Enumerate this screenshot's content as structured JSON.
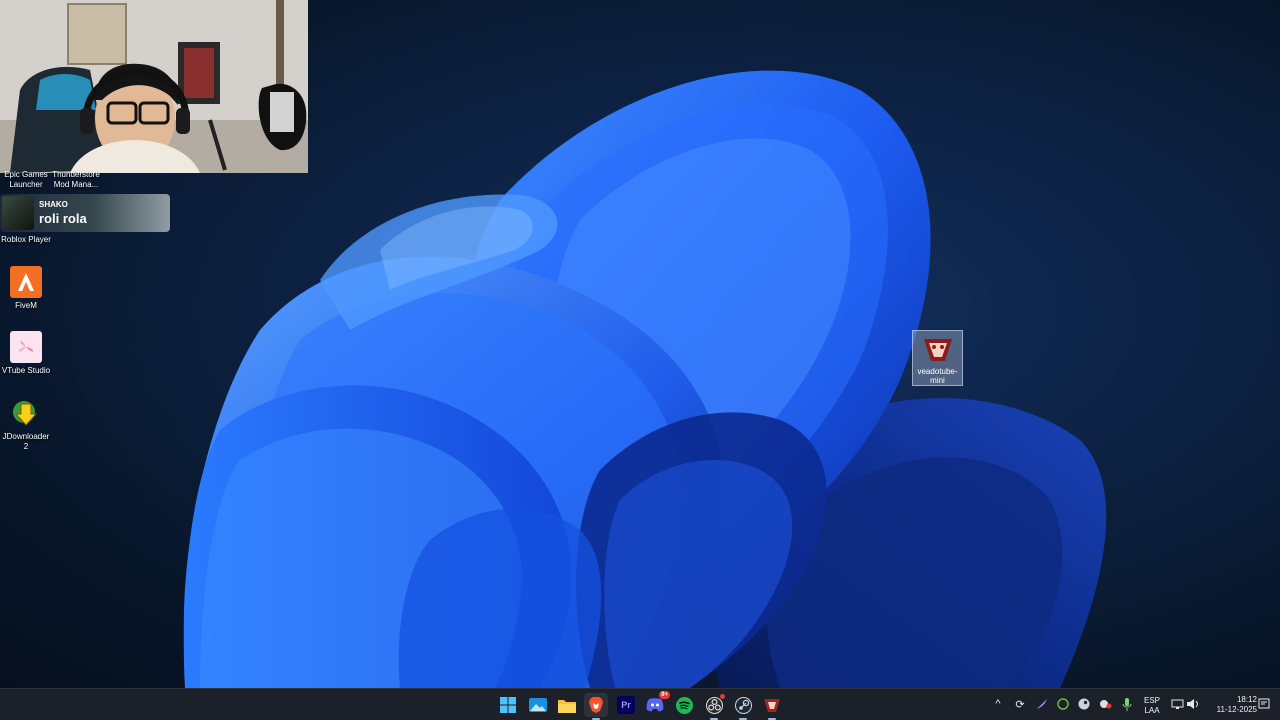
{
  "desktop": {
    "icons": [
      {
        "id": "epic",
        "label": "Epic Games Launcher"
      },
      {
        "id": "thunderstore",
        "label": "Thunderstore Mod Mana..."
      },
      {
        "id": "roblox",
        "label": "Roblox Player"
      },
      {
        "id": "fivem",
        "label": "FiveM"
      },
      {
        "id": "vtube",
        "label": "VTube Studio"
      },
      {
        "id": "jdownloader",
        "label": "JDownloader 2"
      },
      {
        "id": "veadotube",
        "label": "veadotube-mini"
      }
    ]
  },
  "notification": {
    "user": "SHAKO",
    "message": "roli rola"
  },
  "taskbar": {
    "apps": [
      {
        "name": "start",
        "icon": "windows-logo-icon"
      },
      {
        "name": "photos",
        "icon": "photos-icon"
      },
      {
        "name": "file-explorer",
        "icon": "folder-icon"
      },
      {
        "name": "brave",
        "icon": "brave-lion-icon"
      },
      {
        "name": "premiere",
        "icon": "premiere-icon",
        "text": "Pr"
      },
      {
        "name": "discord",
        "icon": "discord-icon",
        "badge": "9+"
      },
      {
        "name": "spotify",
        "icon": "spotify-icon"
      },
      {
        "name": "obs",
        "icon": "obs-icon"
      },
      {
        "name": "steam",
        "icon": "steam-icon"
      },
      {
        "name": "veadotube",
        "icon": "veadotube-icon"
      }
    ],
    "tray": {
      "language_top": "ESP",
      "language_bottom": "LAA",
      "time": "18:12",
      "date": "11-12-2025"
    }
  },
  "colors": {
    "accent": "#1f6fff",
    "taskbar_bg": "#1c2028",
    "spotify": "#1db954",
    "discord": "#5865f2"
  }
}
